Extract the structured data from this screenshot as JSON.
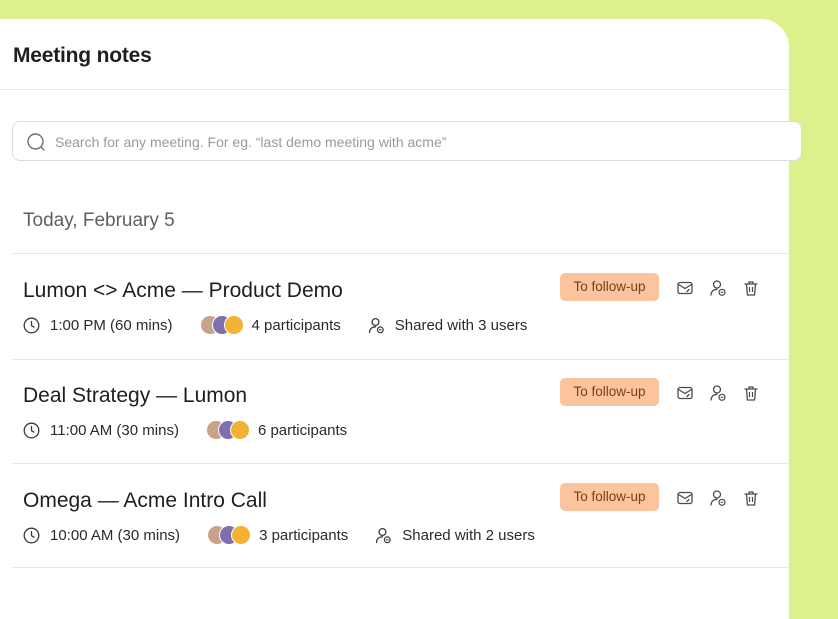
{
  "header": {
    "title": "Meeting notes"
  },
  "search": {
    "placeholder": "Search for any meeting. For eg. “last demo meeting with acme”"
  },
  "date_group": "Today, February 5",
  "colors": {
    "background": "#dcf08c",
    "tag_bg": "#fbc49c",
    "tag_text": "#7a3e16"
  },
  "icons": [
    "search-icon",
    "clock-icon",
    "participant-avatars",
    "shared-users-icon",
    "follow-up-mail-icon",
    "share-user-icon",
    "delete-icon"
  ],
  "meetings": [
    {
      "title": "Lumon <> Acme — Product Demo",
      "time": "1:00 PM (60 mins)",
      "participants": "4 participants",
      "shared": "Shared with 3 users",
      "tag": "To follow-up"
    },
    {
      "title": "Deal Strategy — Lumon",
      "time": "11:00 AM (30 mins)",
      "participants": "6 participants",
      "shared": "",
      "tag": "To follow-up"
    },
    {
      "title": "Omega — Acme Intro Call",
      "time": "10:00 AM (30 mins)",
      "participants": "3 participants",
      "shared": "Shared with 2 users",
      "tag": "To follow-up"
    }
  ]
}
